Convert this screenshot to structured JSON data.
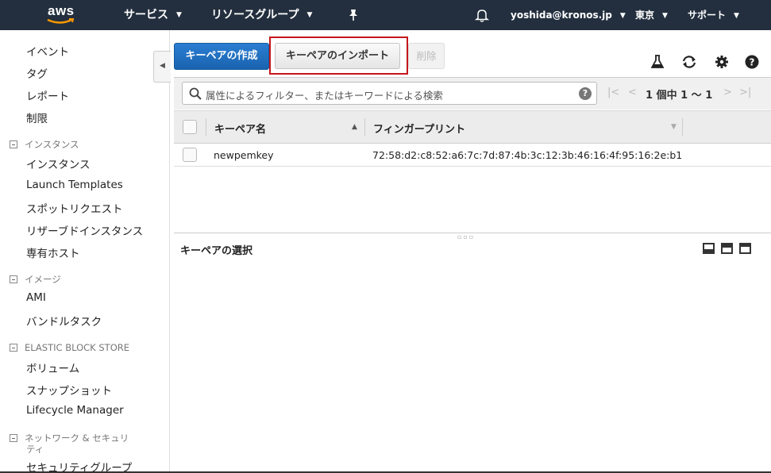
{
  "topnav": {
    "logo_text": "aws",
    "services": "サービス",
    "resource_groups": "リソースグループ",
    "user": "yoshida@kronos.jp",
    "region": "東京",
    "support": "サポート",
    "icons": [
      "pin-icon",
      "bell-icon"
    ]
  },
  "sidebar": {
    "items_top": [
      "イベント",
      "タグ",
      "レポート",
      "制限"
    ],
    "section_instances": "インスタンス",
    "instances": [
      "インスタンス",
      "Launch Templates",
      "スポットリクエスト",
      "リザーブドインスタンス",
      "専有ホスト"
    ],
    "section_images": "イメージ",
    "images": [
      "AMI",
      "バンドルタスク"
    ],
    "section_ebs": "ELASTIC BLOCK STORE",
    "ebs": [
      "ボリューム",
      "スナップショット",
      "Lifecycle Manager"
    ],
    "section_network_1": "ネットワーク & セキュリ",
    "section_network_2": "ティ",
    "network_partial": "セキュリティグループ"
  },
  "toolbar": {
    "create_label": "キーペアの作成",
    "import_label": "キーペアのインポート",
    "delete_label": "削除",
    "icons": [
      "flask-icon",
      "refresh-icon",
      "gear-icon",
      "help-icon"
    ]
  },
  "search": {
    "placeholder": "属性によるフィルター、またはキーワードによる検索",
    "help": "?"
  },
  "pager": {
    "text": "1 個中 1 ～ 1"
  },
  "table": {
    "columns": [
      "キーペア名",
      "フィンガープリント"
    ],
    "rows": [
      {
        "name": "newpemkey",
        "fingerprint": "72:58:d2:c8:52:a6:7c:7d:87:4b:3c:12:3b:46:16:4f:95:16:2e:b1"
      }
    ]
  },
  "detail": {
    "title": "キーペアの選択"
  },
  "colors": {
    "nav_bg": "#232f3e",
    "primary": "#1d6fbf",
    "highlight": "#c4161c"
  }
}
